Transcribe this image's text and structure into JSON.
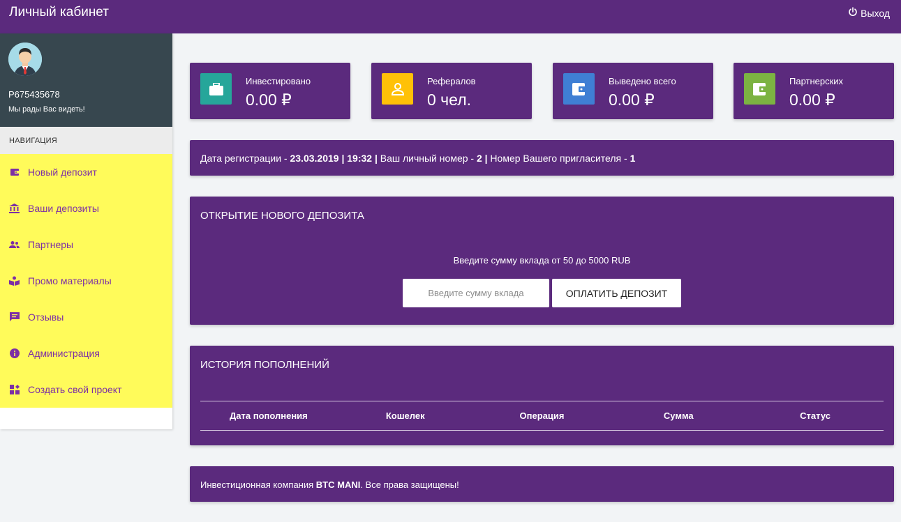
{
  "header": {
    "title": "Личный кабинет",
    "logout_label": "Выход"
  },
  "profile": {
    "user_id": "P675435678",
    "welcome": "Мы рады Вас видеть!"
  },
  "nav": {
    "heading": "НАВИГАЦИЯ",
    "items": [
      {
        "label": "Новый депозит",
        "icon": "wallet-icon"
      },
      {
        "label": "Ваши депозиты",
        "icon": "bank-icon"
      },
      {
        "label": "Партнеры",
        "icon": "people-icon"
      },
      {
        "label": "Промо материалы",
        "icon": "book-icon"
      },
      {
        "label": "Отзывы",
        "icon": "chat-icon"
      },
      {
        "label": "Администрация",
        "icon": "info-icon"
      },
      {
        "label": "Создать свой проект",
        "icon": "widgets-icon"
      }
    ]
  },
  "stats": [
    {
      "label": "Инвестировано",
      "value": "0.00 ₽",
      "icon": "briefcase-icon",
      "color": "#26a69a"
    },
    {
      "label": "Рефералов",
      "value": "0 чел.",
      "icon": "person-icon",
      "color": "#ffc107"
    },
    {
      "label": "Выведено всего",
      "value": "0.00 ₽",
      "icon": "wallet-icon",
      "color": "#3f7fd4"
    },
    {
      "label": "Партнерских",
      "value": "0.00 ₽",
      "icon": "wallet-icon",
      "color": "#7cb342"
    }
  ],
  "reg_info": {
    "date_label": "Дата регистрации - ",
    "date_value": "23.03.2019 | 19:32 |",
    "personal_label": " Ваш личный номер - ",
    "personal_value": "2 |",
    "inviter_label": " Номер Вашего пригласителя - ",
    "inviter_value": "1"
  },
  "deposit": {
    "title": "ОТКРЫТИЕ НОВОГО ДЕПОЗИТА",
    "hint": "Введите сумму вклада от 50 до 5000 RUB",
    "amount_placeholder": "Введите сумму вклада",
    "pay_label": "ОПЛАТИТЬ ДЕПОЗИТ"
  },
  "history": {
    "title": "ИСТОРИЯ ПОПОЛНЕНИЙ",
    "columns": [
      "Дата пополнения",
      "Кошелек",
      "Операция",
      "Сумма",
      "Статус"
    ]
  },
  "footer": {
    "prefix": "Инвестиционная компания ",
    "company": "BTC MANI",
    "suffix": ". Все права защищены!"
  },
  "colors": {
    "brand": "#5b2a7d",
    "sidebar_nav": "#fffb5a",
    "nav_text": "#7d2fa5",
    "profile_bg": "#37474f"
  }
}
